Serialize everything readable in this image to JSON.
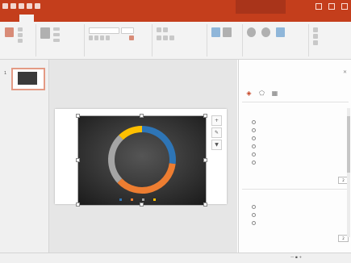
{
  "ribbon_tabs": [
    "",
    "",
    "",
    "",
    "",
    "",
    "",
    "",
    "",
    "",
    "",
    "",
    ""
  ],
  "colors": {
    "accent": "#c43e1c",
    "chart_bg": "#2f2f2f",
    "blue": "#2e75b6",
    "orange": "#ed7d31",
    "yellow": "#ffc000",
    "gray": "#a5a5a5"
  },
  "chart_data": {
    "type": "pie",
    "variant": "doughnut",
    "title": "",
    "legend": "bottom",
    "series": [
      {
        "name": "",
        "color": "#2e75b6",
        "value": 27
      },
      {
        "name": "",
        "color": "#ed7d31",
        "value": 36
      },
      {
        "name": "",
        "color": "#a5a5a5",
        "value": 25
      },
      {
        "name": "",
        "color": "#ffc000",
        "value": 12
      }
    ]
  },
  "pane": {
    "section1_items": [
      "",
      "",
      "",
      "",
      "",
      ""
    ],
    "section2_items": [
      "",
      "",
      ""
    ],
    "dropdown_value": "2"
  }
}
